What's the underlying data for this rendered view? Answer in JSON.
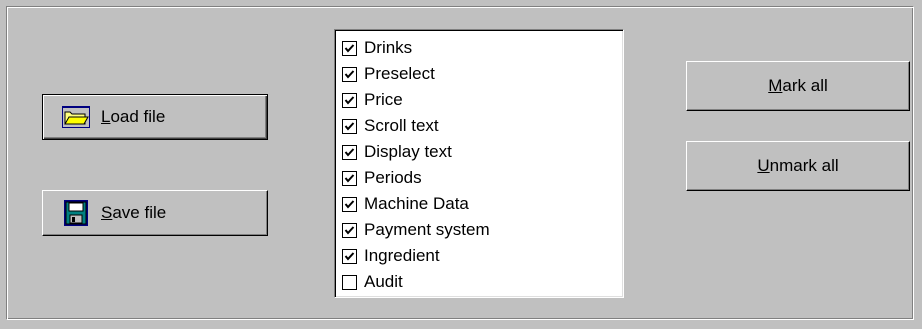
{
  "buttons": {
    "load": {
      "prefix": "",
      "accel": "L",
      "rest": "oad file",
      "icon": "folder-open-icon"
    },
    "save": {
      "prefix": "",
      "accel": "S",
      "rest": "ave file",
      "icon": "floppy-disk-icon"
    },
    "mark_all": {
      "accel": "M",
      "rest": "ark all"
    },
    "unmark_all": {
      "accel": "U",
      "rest": "nmark all"
    }
  },
  "list": {
    "items": [
      {
        "label": "Drinks",
        "checked": true
      },
      {
        "label": "Preselect",
        "checked": true
      },
      {
        "label": "Price",
        "checked": true
      },
      {
        "label": "Scroll text",
        "checked": true
      },
      {
        "label": "Display text",
        "checked": true
      },
      {
        "label": "Periods",
        "checked": true
      },
      {
        "label": "Machine Data",
        "checked": true
      },
      {
        "label": "Payment system",
        "checked": true
      },
      {
        "label": "Ingredient",
        "checked": true
      },
      {
        "label": "Audit",
        "checked": false
      }
    ]
  },
  "colors": {
    "face": "#c0c0c0",
    "folder": "#ffff80",
    "disk": "#008080"
  }
}
